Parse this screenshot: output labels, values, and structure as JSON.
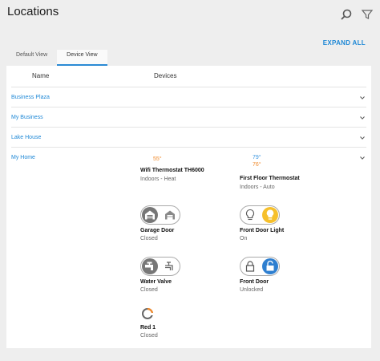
{
  "header": {
    "title": "Locations",
    "search_icon": "search-icon",
    "filter_icon": "filter-icon",
    "expand_all": "EXPAND ALL"
  },
  "tabs": [
    {
      "label": "Default View",
      "active": false
    },
    {
      "label": "Device View",
      "active": true
    }
  ],
  "table": {
    "col_name": "Name",
    "col_devices": "Devices"
  },
  "locations": [
    {
      "name": "Business Plaza",
      "expanded": false
    },
    {
      "name": "My Business",
      "expanded": false
    },
    {
      "name": "Lake House",
      "expanded": false
    },
    {
      "name": "My Home",
      "expanded": true
    }
  ],
  "devices": {
    "wifi_thermostat": {
      "temp": "55°",
      "name": "Wifi Thermostat TH6000",
      "status": "Indoors - Heat"
    },
    "first_floor_thermostat": {
      "temp_cool": "79°",
      "temp_heat": "76°",
      "name": "First Floor Thermostat",
      "status": "Indoors - Auto"
    },
    "garage_door": {
      "name": "Garage Door",
      "status": "Closed"
    },
    "front_door_light": {
      "name": "Front Door Light",
      "status": "On"
    },
    "water_valve": {
      "name": "Water Valve",
      "status": "Closed"
    },
    "front_door": {
      "name": "Front Door",
      "status": "Unlocked"
    },
    "red1": {
      "name": "Red 1",
      "status": "Closed"
    }
  },
  "colors": {
    "accent": "#1e88d6",
    "heat": "#f08a2c",
    "cool": "#3a96e0",
    "light_on": "#f6c02c"
  }
}
